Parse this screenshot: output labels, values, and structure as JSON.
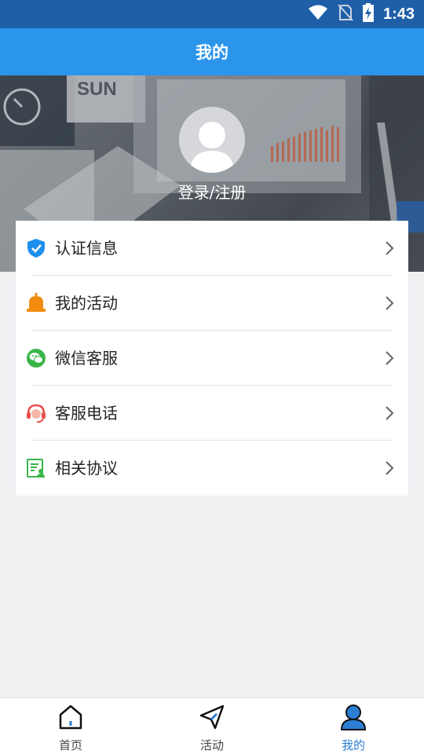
{
  "status_bar": {
    "time": "1:43",
    "icons": [
      "wifi-icon",
      "no-sim-icon",
      "battery-charging-icon"
    ]
  },
  "header": {
    "title": "我的"
  },
  "profile": {
    "avatar_icon": "user-avatar-icon",
    "login_label": "登录/注册"
  },
  "menu": {
    "items": [
      {
        "label": "认证信息",
        "icon": "verified-shield-icon",
        "color": "#1e8fec"
      },
      {
        "label": "我的活动",
        "icon": "bell-icon",
        "color": "#f38c10"
      },
      {
        "label": "微信客服",
        "icon": "wechat-icon",
        "color": "#3ab54a"
      },
      {
        "label": "客服电话",
        "icon": "headset-icon",
        "color": "#e9514b"
      },
      {
        "label": "相关协议",
        "icon": "agreement-document-icon",
        "color": "#3ab54a"
      }
    ]
  },
  "tab_bar": {
    "tabs": [
      {
        "label": "首页",
        "icon": "home-icon",
        "active": false
      },
      {
        "label": "活动",
        "icon": "paper-plane-icon",
        "active": false
      },
      {
        "label": "我的",
        "icon": "user-icon",
        "active": true
      }
    ],
    "active_color": "#2b7fd4"
  }
}
